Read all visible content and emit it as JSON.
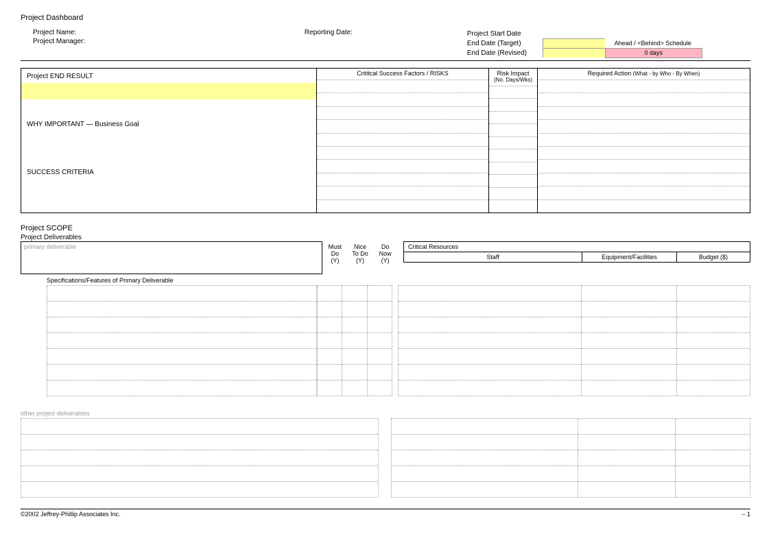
{
  "title": "Project Dashboard",
  "header": {
    "project_name_label": "Project Name:",
    "project_manager_label": "Project Manager:",
    "reporting_date_label": "Reporting Date:",
    "start_date_label": "Project Start Date",
    "end_target_label": "End Date (Target)",
    "end_revised_label": "End Date (Revised)",
    "ahead_behind_label": "Ahead / <Behind> Schedule",
    "days_value": "0 days"
  },
  "section1": {
    "end_result_label": "Project END RESULT",
    "why_important_label": "WHY IMPORTANT — Business Goal",
    "success_criteria_label": "SUCCESS CRITERIA",
    "csf_header": "Crititcal Success Factors / RISKS",
    "risk_header": "Risk Impact",
    "risk_sub": "(No. Days/Wks)",
    "required_action_header": "Required Action",
    "required_action_sub": "(What - by Who - By When)"
  },
  "scope": {
    "title": "Project SCOPE",
    "deliverables_label": "Project Deliverables",
    "primary_placeholder": "primary deliverable",
    "must_do": "Must\nDo\n(Y)",
    "nice_todo": "Nice\nTo Do\n(Y)",
    "do_now": "Do\nNow\n(Y)",
    "critical_resources": "Critical Resources",
    "staff": "Staff",
    "equipment": "Equipment/Facilities",
    "budget": "Budget ($)",
    "spec_title": "Specifications/Features of Primary Deliverable",
    "other_title": "other project deliverables"
  },
  "footer": {
    "copyright": "©2002 Jeffrey-Phillip Associates Inc.",
    "page": "– 1"
  }
}
